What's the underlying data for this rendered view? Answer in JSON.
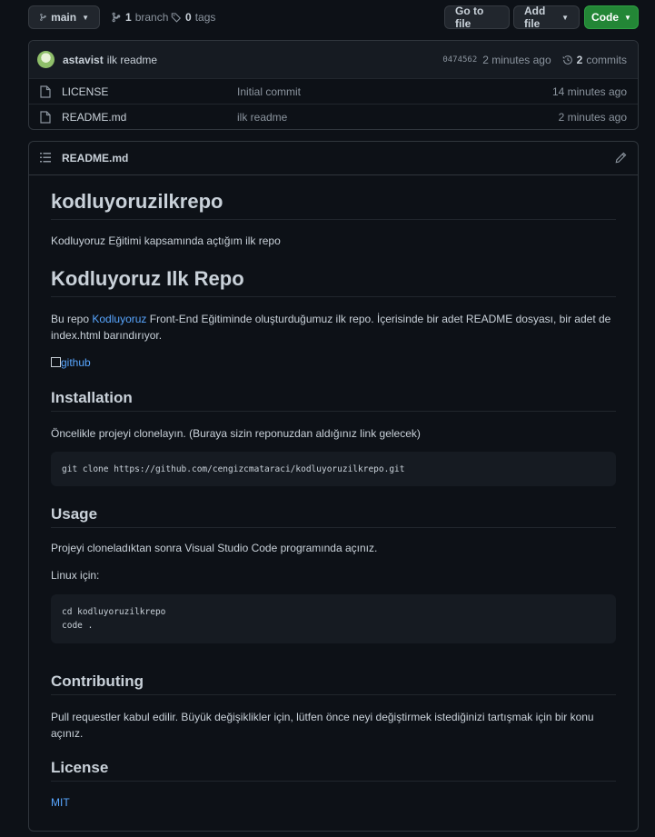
{
  "topbar": {
    "branch_label": "main",
    "branch_count": "1",
    "branch_word": "branch",
    "tag_count": "0",
    "tag_word": "tags",
    "go_to_file": "Go to file",
    "add_file": "Add file",
    "code": "Code"
  },
  "latest_commit": {
    "author": "astavist",
    "message": "ilk readme",
    "sha": "0474562",
    "time": "2 minutes ago",
    "commit_count": "2",
    "commit_word": "commits"
  },
  "files": [
    {
      "name": "LICENSE",
      "commit": "Initial commit",
      "age": "14 minutes ago"
    },
    {
      "name": "README.md",
      "commit": "ilk readme",
      "age": "2 minutes ago"
    }
  ],
  "readme": {
    "file_title": "README.md",
    "h1_main": "kodluyoruzilkrepo",
    "intro": "Kodluyoruz Eğitimi kapsamında açtığım ilk repo",
    "h1_second": "Kodluyoruz Ilk Repo",
    "desc_before": "Bu repo ",
    "desc_link": "Kodluyoruz",
    "desc_after": " Front-End Eğitiminde oluşturduğumuz ilk repo. İçerisinde bir adet README dosyası, bir adet de index.html barındırıyor.",
    "image_alt": "github",
    "installation_heading": "Installation",
    "installation_text": "Öncelikle projeyi clonelayın. (Buraya sizin reponuzdan aldığınız link gelecek)",
    "installation_code": "git clone https://github.com/cengizcmataraci/kodluyoruzilkrepo.git",
    "usage_heading": "Usage",
    "usage_text": "Projeyi cloneladıktan sonra Visual Studio Code programında açınız.",
    "linux_label": "Linux için:",
    "usage_code_line1": "cd kodluyoruzilkrepo",
    "usage_code_line2": "code .",
    "contributing_heading": "Contributing",
    "contributing_text": "Pull requestler kabul edilir. Büyük değişiklikler için, lütfen önce neyi değiştirmek istediğinizi tartışmak için bir konu açınız.",
    "license_heading": "License",
    "license_link": "MIT"
  },
  "colors": {
    "background": "#0d1117",
    "border": "#30363d",
    "text": "#c9d1d9",
    "muted": "#8b949e",
    "link": "#58a6ff",
    "code_button": "#238636"
  },
  "icons": [
    "branch-icon",
    "tag-icon",
    "history-icon",
    "file-icon",
    "list-icon",
    "pencil-icon",
    "caret-down-icon"
  ]
}
